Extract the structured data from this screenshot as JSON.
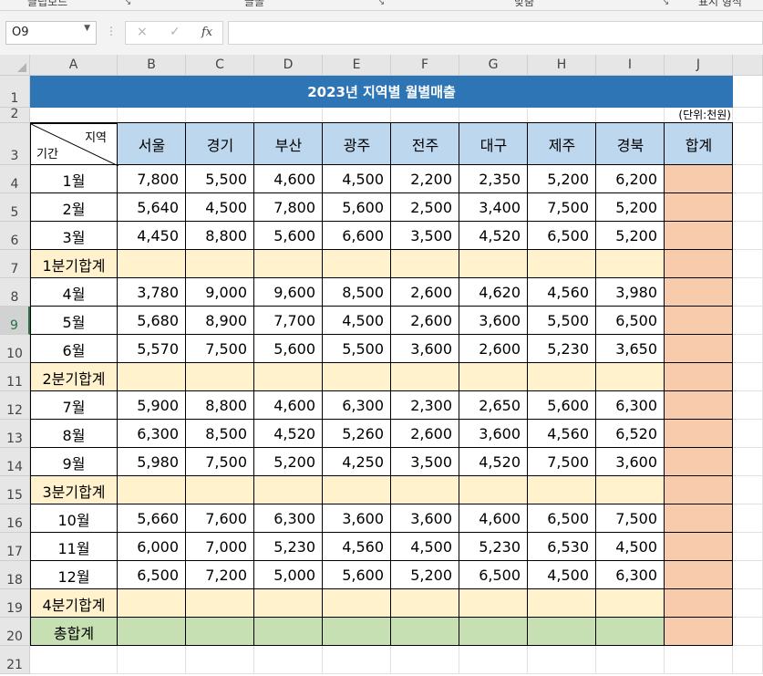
{
  "ribbon": {
    "groups": [
      "클립보드",
      "글꼴",
      "맞춤",
      "표시 형식"
    ]
  },
  "formula_bar": {
    "name_box": "O9",
    "cancel_icon": "×",
    "enter_icon": "✓",
    "fx_label": "fx",
    "formula": ""
  },
  "sheet": {
    "columns": [
      "A",
      "B",
      "C",
      "D",
      "E",
      "F",
      "G",
      "H",
      "I",
      "J"
    ],
    "rows": [
      "1",
      "2",
      "3",
      "4",
      "5",
      "6",
      "7",
      "8",
      "9",
      "10",
      "11",
      "12",
      "13",
      "14",
      "15",
      "16",
      "17",
      "18",
      "19",
      "20",
      "21"
    ],
    "selected_row": "9",
    "title": "2023년 지역별 월별매출",
    "unit": "(단위:천원)",
    "corner_top": "지역",
    "corner_bottom": "기간",
    "region_headers": [
      "서울",
      "경기",
      "부산",
      "광주",
      "전주",
      "대구",
      "제주",
      "경북"
    ],
    "total_header": "합계",
    "body": [
      {
        "label": "1월",
        "type": "month",
        "values": [
          "7,800",
          "5,500",
          "4,600",
          "4,500",
          "2,200",
          "2,350",
          "5,200",
          "6,200"
        ]
      },
      {
        "label": "2월",
        "type": "month",
        "values": [
          "5,640",
          "4,500",
          "7,800",
          "5,600",
          "2,500",
          "3,400",
          "7,500",
          "5,200"
        ]
      },
      {
        "label": "3월",
        "type": "month",
        "values": [
          "4,450",
          "8,800",
          "5,600",
          "6,600",
          "3,500",
          "4,520",
          "6,500",
          "5,200"
        ]
      },
      {
        "label": "1분기합계",
        "type": "quarter",
        "values": [
          "",
          "",
          "",
          "",
          "",
          "",
          "",
          ""
        ]
      },
      {
        "label": "4월",
        "type": "month",
        "values": [
          "3,780",
          "9,000",
          "9,600",
          "8,500",
          "2,600",
          "4,620",
          "4,560",
          "3,980"
        ]
      },
      {
        "label": "5월",
        "type": "month",
        "values": [
          "5,680",
          "8,900",
          "7,700",
          "4,500",
          "2,600",
          "3,600",
          "5,500",
          "6,500"
        ]
      },
      {
        "label": "6월",
        "type": "month",
        "values": [
          "5,570",
          "7,500",
          "5,600",
          "5,500",
          "3,600",
          "2,600",
          "5,230",
          "3,650"
        ]
      },
      {
        "label": "2분기합계",
        "type": "quarter",
        "values": [
          "",
          "",
          "",
          "",
          "",
          "",
          "",
          ""
        ]
      },
      {
        "label": "7월",
        "type": "month",
        "values": [
          "5,900",
          "8,800",
          "4,600",
          "6,300",
          "2,300",
          "2,650",
          "5,600",
          "6,300"
        ]
      },
      {
        "label": "8월",
        "type": "month",
        "values": [
          "6,300",
          "8,500",
          "4,520",
          "5,260",
          "2,600",
          "3,600",
          "4,560",
          "6,520"
        ]
      },
      {
        "label": "9월",
        "type": "month",
        "values": [
          "5,980",
          "7,500",
          "5,200",
          "4,250",
          "3,500",
          "4,520",
          "7,500",
          "3,600"
        ]
      },
      {
        "label": "3분기합계",
        "type": "quarter",
        "values": [
          "",
          "",
          "",
          "",
          "",
          "",
          "",
          ""
        ]
      },
      {
        "label": "10월",
        "type": "month",
        "values": [
          "5,660",
          "7,600",
          "6,300",
          "3,600",
          "3,600",
          "4,600",
          "6,500",
          "7,500"
        ]
      },
      {
        "label": "11월",
        "type": "month",
        "values": [
          "6,000",
          "7,000",
          "5,230",
          "4,560",
          "4,500",
          "5,230",
          "6,530",
          "4,500"
        ]
      },
      {
        "label": "12월",
        "type": "month",
        "values": [
          "6,500",
          "7,200",
          "5,000",
          "5,600",
          "5,200",
          "6,500",
          "4,500",
          "6,300"
        ]
      },
      {
        "label": "4분기합계",
        "type": "quarter",
        "values": [
          "",
          "",
          "",
          "",
          "",
          "",
          "",
          ""
        ]
      },
      {
        "label": "총합계",
        "type": "grand",
        "values": [
          "",
          "",
          "",
          "",
          "",
          "",
          "",
          ""
        ]
      }
    ]
  },
  "colors": {
    "title_bg": "#2e75b6",
    "header_bg": "#bdd7ee",
    "quarter_bg": "#fff2cc",
    "total_col_bg": "#f8cbad",
    "grand_bg": "#c6e0b4",
    "excel_green": "#217346"
  }
}
